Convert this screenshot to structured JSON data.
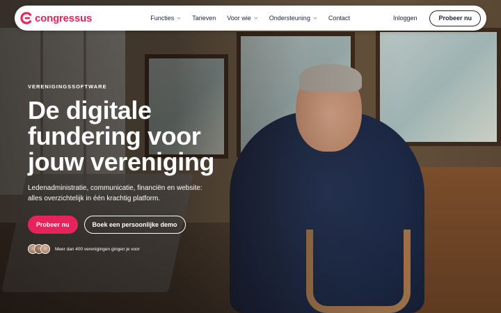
{
  "brand": {
    "name": "congressus",
    "color": "#e4245b",
    "logo_icon": "congressus-logo-icon"
  },
  "nav": {
    "items": [
      {
        "label": "Functies",
        "has_dropdown": true
      },
      {
        "label": "Tarieven",
        "has_dropdown": false
      },
      {
        "label": "Voor wie",
        "has_dropdown": true
      },
      {
        "label": "Ondersteuning",
        "has_dropdown": true
      },
      {
        "label": "Contact",
        "has_dropdown": false
      }
    ],
    "login_label": "Inloggen",
    "try_label": "Probeer nu"
  },
  "hero": {
    "eyebrow": "VERENIGINGSSOFTWARE",
    "headline_lines": [
      "De digitale",
      "fundering voor",
      "jouw vereniging"
    ],
    "subtext_lines": [
      "Ledenadministratie, communicatie, financiën en website:",
      "alles overzichtelijk in één krachtig platform."
    ],
    "primary_cta": "Probeer nu",
    "secondary_cta": "Boek een persoonlijke demo",
    "social_proof": "Meer dan 400 verenigingen gingen je voor"
  },
  "colors": {
    "accent": "#e4245b",
    "navy": "#1d2340",
    "white": "#ffffff"
  }
}
